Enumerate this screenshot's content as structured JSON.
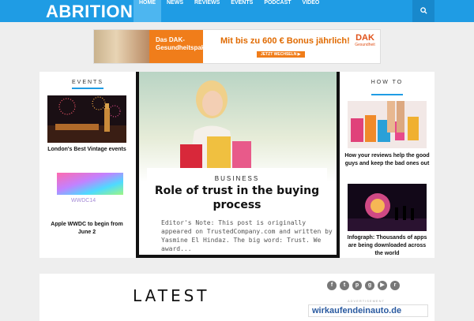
{
  "header": {
    "logo": "ABRITION",
    "nav": [
      "HOME",
      "NEWS",
      "REVIEWS",
      "EVENTS",
      "PODCAST",
      "VIDEO"
    ],
    "search_icon": "search-icon"
  },
  "banner": {
    "line1": "Das DAK-Gesundheitspaket",
    "line2": "Mit bis zu 600 € Bonus jährlich!",
    "cta": "JETZT WECHSELN ▶",
    "brand": "DAK",
    "brand_sub": "Gesundheit"
  },
  "events": {
    "title": "EVENTS",
    "items": [
      {
        "caption": "London's Best Vintage events"
      },
      {
        "caption": "Apple WWDC to begin from June 2",
        "thumb_text": "WWDC14"
      }
    ]
  },
  "featured": {
    "category": "BUSINESS",
    "title": "Role of trust in the buying process",
    "excerpt": "Editor's Note: This post is originally appeared on TrustedCompany.com and written by Yasmine El Hindaz. The big word: Trust. We award..."
  },
  "howto": {
    "title": "HOW TO",
    "items": [
      {
        "caption": "How your reviews help the good guys and keep the bad ones out"
      },
      {
        "caption": "Infograph: Thousands of apps are being downloaded across the world"
      }
    ]
  },
  "latest": {
    "title": "LATEST"
  },
  "social_icons": [
    "facebook-icon",
    "twitter-icon",
    "pinterest-icon",
    "google-plus-icon",
    "youtube-icon",
    "rss-icon"
  ],
  "sidebar_ad": {
    "label": "ADVERTISEMENT",
    "text": "wirkaufendeinauto.de"
  },
  "colors": {
    "accent": "#1f9ce4",
    "banner_orange": "#f07d1a"
  }
}
